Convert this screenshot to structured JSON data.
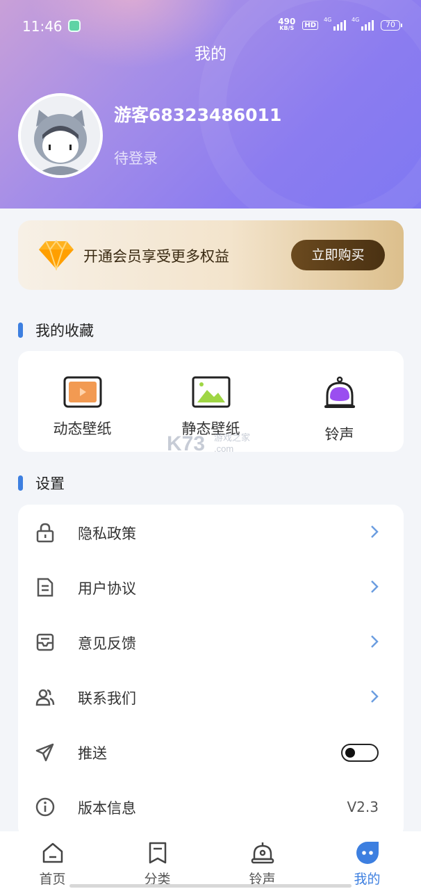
{
  "status_bar": {
    "time": "11:46",
    "net_speed_value": "490",
    "net_speed_unit": "KB/S",
    "hd_badge": "HD",
    "sim1_tag": "4G",
    "sim2_tag": "4G",
    "battery": "70"
  },
  "header": {
    "title": "我的",
    "username": "游客68323486011",
    "login_status": "待登录"
  },
  "vip": {
    "text": "开通会员享受更多权益",
    "button_label": "立即购买"
  },
  "favorites": {
    "title": "我的收藏",
    "items": [
      {
        "label": "动态壁纸",
        "icon": "video-wallpaper-icon"
      },
      {
        "label": "静态壁纸",
        "icon": "image-wallpaper-icon"
      },
      {
        "label": "铃声",
        "icon": "bell-icon"
      }
    ]
  },
  "watermark": {
    "brand": "K73",
    "sub": "游戏之家",
    "domain": ".com"
  },
  "settings": {
    "title": "设置",
    "items": [
      {
        "label": "隐私政策",
        "icon": "lock-icon"
      },
      {
        "label": "用户协议",
        "icon": "document-icon"
      },
      {
        "label": "意见反馈",
        "icon": "inbox-icon"
      },
      {
        "label": "联系我们",
        "icon": "contacts-icon"
      },
      {
        "label": "推送",
        "icon": "send-icon",
        "toggle_on": false
      },
      {
        "label": "版本信息",
        "icon": "info-icon",
        "value": "V2.3"
      }
    ]
  },
  "tabbar": {
    "items": [
      {
        "label": "首页",
        "icon": "home-icon"
      },
      {
        "label": "分类",
        "icon": "bookmark-icon"
      },
      {
        "label": "铃声",
        "icon": "alarm-bell-icon"
      },
      {
        "label": "我的",
        "icon": "profile-dots-icon",
        "active": true
      }
    ]
  },
  "colors": {
    "accent": "#3d7fe0",
    "header_gradient_start": "#c9a0d8",
    "header_gradient_end": "#7f78f2",
    "vip_button": "#5a3d18"
  }
}
